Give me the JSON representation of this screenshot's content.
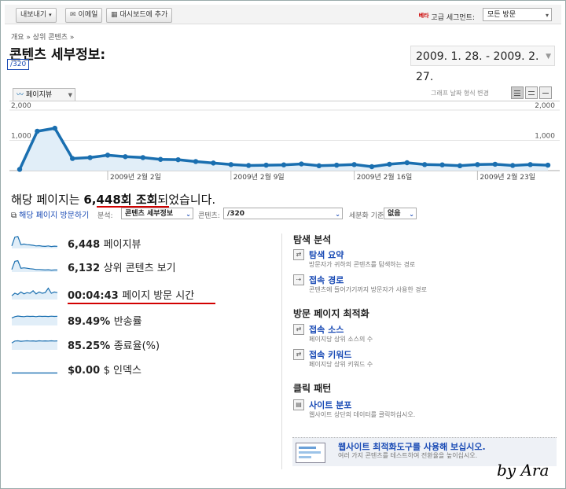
{
  "toolbar": {
    "export_label": "내보내기",
    "email_label": "이메일",
    "dashboard_label": "대시보드에 추가",
    "advanced_badge": "베타",
    "segment_label": "고급 세그먼트:",
    "segment_value": "모든 방문"
  },
  "breadcrumb": "개요 » 상위 콘텐츠 »",
  "page_title": "콘텐츠 세부정보:",
  "page_path": "/320",
  "date_range": "2009. 1. 28. - 2009. 2. 27.",
  "chart_controls": {
    "metric_tab": "페이지뷰",
    "graph_mode_label": "그래프 날짜 형식 변경"
  },
  "chart_data": {
    "type": "area",
    "title": "",
    "ylabel": "",
    "xlabel": "",
    "ylim": [
      0,
      2000
    ],
    "y_ticks": [
      "2,000",
      "1,000"
    ],
    "x_tick_labels": [
      "2009년 2월 2일",
      "2009년 2월 9일",
      "2009년 2월 16일",
      "2009년 2월 23일"
    ],
    "grid": true,
    "x": [
      "2009-01-28",
      "2009-01-29",
      "2009-01-30",
      "2009-01-31",
      "2009-02-01",
      "2009-02-02",
      "2009-02-03",
      "2009-02-04",
      "2009-02-05",
      "2009-02-06",
      "2009-02-07",
      "2009-02-08",
      "2009-02-09",
      "2009-02-10",
      "2009-02-11",
      "2009-02-12",
      "2009-02-13",
      "2009-02-14",
      "2009-02-15",
      "2009-02-16",
      "2009-02-17",
      "2009-02-18",
      "2009-02-19",
      "2009-02-20",
      "2009-02-21",
      "2009-02-22",
      "2009-02-23",
      "2009-02-24",
      "2009-02-25",
      "2009-02-26",
      "2009-02-27"
    ],
    "series": [
      {
        "values": [
          40,
          1300,
          1400,
          400,
          430,
          510,
          460,
          430,
          370,
          360,
          300,
          250,
          200,
          170,
          180,
          190,
          220,
          160,
          180,
          200,
          130,
          210,
          260,
          200,
          190,
          160,
          200,
          210,
          170,
          200,
          180
        ]
      }
    ]
  },
  "summary": {
    "prefix": "해당 페이지는 ",
    "count": "6,448회 조회",
    "suffix": "되었습니다."
  },
  "filters": {
    "visits_link": "해당 페이지 방문하기",
    "analyze_label": "분석:",
    "analyze_value": "콘텐츠 세부정보",
    "content_label": "콘텐츠:",
    "content_value": "/320",
    "subdivide_label": "세분화 기준:",
    "subdivide_value": "없음"
  },
  "metrics": [
    {
      "value": "6,448",
      "label": "페이지뷰",
      "spark": [
        0.2,
        0.9,
        0.95,
        0.3,
        0.35,
        0.3,
        0.28,
        0.25,
        0.2,
        0.22,
        0.18,
        0.16,
        0.2,
        0.15,
        0.18,
        0.17
      ]
    },
    {
      "value": "6,132",
      "label": "상위 콘텐츠 보기",
      "spark": [
        0.2,
        0.85,
        0.9,
        0.3,
        0.33,
        0.3,
        0.26,
        0.24,
        0.2,
        0.2,
        0.18,
        0.16,
        0.18,
        0.15,
        0.16,
        0.16
      ]
    },
    {
      "value": "00:04:43",
      "label": "페이지 방문 시간",
      "spark": [
        0.3,
        0.5,
        0.4,
        0.6,
        0.45,
        0.55,
        0.5,
        0.7,
        0.45,
        0.6,
        0.5,
        0.55,
        0.9,
        0.5,
        0.6,
        0.55
      ]
    },
    {
      "value": "89.49%",
      "label": "반송률",
      "spark": [
        0.6,
        0.7,
        0.75,
        0.72,
        0.7,
        0.74,
        0.72,
        0.73,
        0.7,
        0.74,
        0.72,
        0.73,
        0.71,
        0.74,
        0.72,
        0.73
      ]
    },
    {
      "value": "85.25%",
      "label": "종료율(%)",
      "spark": [
        0.55,
        0.7,
        0.72,
        0.68,
        0.7,
        0.72,
        0.7,
        0.71,
        0.69,
        0.72,
        0.7,
        0.71,
        0.7,
        0.72,
        0.7,
        0.71
      ]
    },
    {
      "value": "$0.00",
      "label": "$ 인덱스",
      "spark": [
        0.1,
        0.1,
        0.1,
        0.1,
        0.1,
        0.1,
        0.1,
        0.1,
        0.1,
        0.1,
        0.1,
        0.1,
        0.1,
        0.1,
        0.1,
        0.1
      ]
    }
  ],
  "right_panel": {
    "navigation_title": "탐색 분석",
    "nav_summary": "탐색 요약",
    "nav_summary_desc": "방문자가 귀하의 콘텐츠를 탐색하는 경로",
    "entrance_paths": "접속 경로",
    "entrance_paths_desc": "콘텐츠에 들어가기까지 방문자가 사용한 경로",
    "landing_title": "방문 페이지 최적화",
    "entrance_sources": "접속 소스",
    "entrance_sources_desc": "페이지당 상위 소스의 수",
    "entrance_keywords": "접속 키워드",
    "entrance_keywords_desc": "페이지당 상위 키워드 수",
    "click_title": "클릭 패턴",
    "site_overlay": "사이트 분포",
    "site_overlay_desc": "웹사이트 상단의 데이터를 클릭하십시오.",
    "promo_link": "웹사이트 최적화도구를 사용해 보십시오.",
    "promo_desc": "여러 가지 콘텐츠를 테스트하여 전환율을 높이십시오."
  },
  "signature": "by Ara",
  "colors": {
    "accent": "#1a6fb0",
    "link": "#1a4bb5",
    "highlight": "#d20000"
  }
}
